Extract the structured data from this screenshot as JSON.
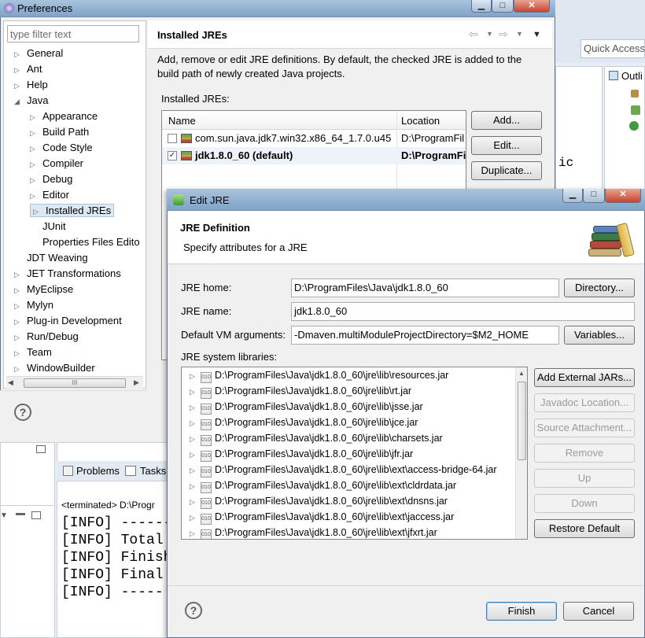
{
  "preferences": {
    "title": "Preferences",
    "filter_placeholder": "type filter text",
    "tree": [
      {
        "label": "General",
        "level": 0,
        "arrow": "▷"
      },
      {
        "label": "Ant",
        "level": 0,
        "arrow": "▷"
      },
      {
        "label": "Help",
        "level": 0,
        "arrow": "▷"
      },
      {
        "label": "Java",
        "level": 0,
        "arrow": "◢"
      },
      {
        "label": "Appearance",
        "level": 1,
        "arrow": "▷"
      },
      {
        "label": "Build Path",
        "level": 1,
        "arrow": "▷"
      },
      {
        "label": "Code Style",
        "level": 1,
        "arrow": "▷"
      },
      {
        "label": "Compiler",
        "level": 1,
        "arrow": "▷"
      },
      {
        "label": "Debug",
        "level": 1,
        "arrow": "▷"
      },
      {
        "label": "Editor",
        "level": 1,
        "arrow": "▷"
      },
      {
        "label": "Installed JREs",
        "level": 1,
        "arrow": "▷"
      },
      {
        "label": "JUnit",
        "level": 1,
        "arrow": ""
      },
      {
        "label": "Properties Files Edito",
        "level": 1,
        "arrow": ""
      },
      {
        "label": "JDT Weaving",
        "level": 0,
        "arrow": ""
      },
      {
        "label": "JET Transformations",
        "level": 0,
        "arrow": "▷"
      },
      {
        "label": "MyEclipse",
        "level": 0,
        "arrow": "▷"
      },
      {
        "label": "Mylyn",
        "level": 0,
        "arrow": "▷"
      },
      {
        "label": "Plug-in Development",
        "level": 0,
        "arrow": "▷"
      },
      {
        "label": "Run/Debug",
        "level": 0,
        "arrow": "▷"
      },
      {
        "label": "Team",
        "level": 0,
        "arrow": "▷"
      },
      {
        "label": "WindowBuilder",
        "level": 0,
        "arrow": "▷"
      }
    ],
    "page_title": "Installed JREs",
    "description": "Add, remove or edit JRE definitions. By default, the checked JRE is added to the build path of newly created Java projects.",
    "list_label": "Installed JREs:",
    "col_name": "Name",
    "col_location": "Location",
    "jres": [
      {
        "name": "com.sun.java.jdk7.win32.x86_64_1.7.0.u45",
        "location": "D:\\ProgramFil",
        "checked": false,
        "bold": false
      },
      {
        "name": "jdk1.8.0_60 (default)",
        "location": "D:\\ProgramFi",
        "checked": true,
        "bold": true
      }
    ],
    "btn_add": "Add...",
    "btn_edit": "Edit...",
    "btn_duplicate": "Duplicate...",
    "scroll_glyph": "III"
  },
  "ide": {
    "quick_access_placeholder": "Quick Access",
    "outline_label": "Outli",
    "problems_tab": "Problems",
    "tasks_tab": "Tasks",
    "terminated_text": "<terminated> D:\\Progr",
    "console_lines": [
      "[INFO] ------",
      "[INFO] Total",
      "[INFO] Finishe",
      "[INFO] Final M",
      "[INFO] -----"
    ],
    "editor_fragment": "ic"
  },
  "edit_jre": {
    "title": "Edit JRE",
    "heading": "JRE Definition",
    "subheading": "Specify attributes for a JRE",
    "home_label": "JRE home:",
    "home_value": "D:\\ProgramFiles\\Java\\jdk1.8.0_60",
    "directory_btn": "Directory...",
    "name_label": "JRE name:",
    "name_value": "jdk1.8.0_60",
    "vm_label": "Default VM arguments:",
    "vm_value": "-Dmaven.multiModuleProjectDirectory=$M2_HOME",
    "variables_btn": "Variables...",
    "libs_label": "JRE system libraries:",
    "libraries": [
      "D:\\ProgramFiles\\Java\\jdk1.8.0_60\\jre\\lib\\resources.jar",
      "D:\\ProgramFiles\\Java\\jdk1.8.0_60\\jre\\lib\\rt.jar",
      "D:\\ProgramFiles\\Java\\jdk1.8.0_60\\jre\\lib\\jsse.jar",
      "D:\\ProgramFiles\\Java\\jdk1.8.0_60\\jre\\lib\\jce.jar",
      "D:\\ProgramFiles\\Java\\jdk1.8.0_60\\jre\\lib\\charsets.jar",
      "D:\\ProgramFiles\\Java\\jdk1.8.0_60\\jre\\lib\\jfr.jar",
      "D:\\ProgramFiles\\Java\\jdk1.8.0_60\\jre\\lib\\ext\\access-bridge-64.jar",
      "D:\\ProgramFiles\\Java\\jdk1.8.0_60\\jre\\lib\\ext\\cldrdata.jar",
      "D:\\ProgramFiles\\Java\\jdk1.8.0_60\\jre\\lib\\ext\\dnsns.jar",
      "D:\\ProgramFiles\\Java\\jdk1.8.0_60\\jre\\lib\\ext\\jaccess.jar",
      "D:\\ProgramFiles\\Java\\jdk1.8.0_60\\jre\\lib\\ext\\jfxrt.jar"
    ],
    "jar_icon_text": "010",
    "add_external_btn": "Add External JARs...",
    "javadoc_btn": "Javadoc Location...",
    "source_btn": "Source Attachment...",
    "remove_btn": "Remove",
    "up_btn": "Up",
    "down_btn": "Down",
    "restore_btn": "Restore Default",
    "finish_btn": "Finish",
    "cancel_btn": "Cancel",
    "help_glyph": "?"
  },
  "colors": {
    "titlebar": "#8fb0d2",
    "selection": "#dde8f5",
    "accent": "#3c7fb1"
  }
}
